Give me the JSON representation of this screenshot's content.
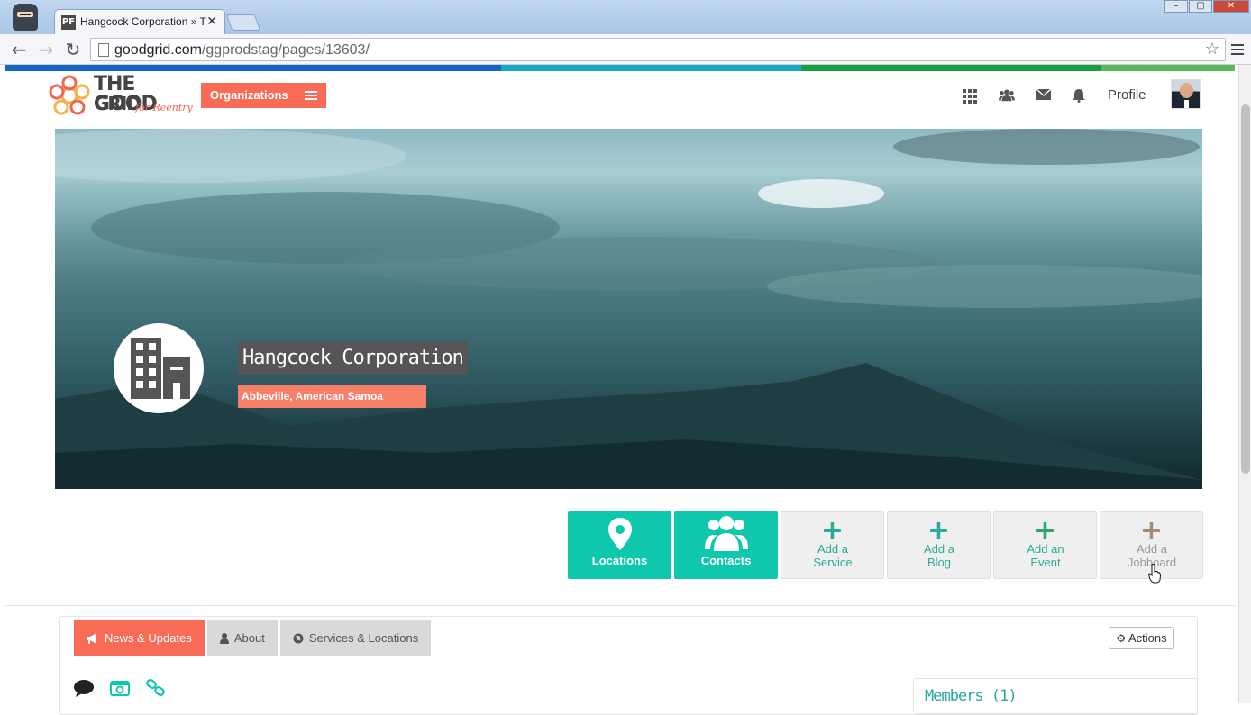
{
  "browser": {
    "tab_title": "Hangcock Corporation » T",
    "tab_favicon": "PF",
    "url_host": "goodgrid.com",
    "url_path": "/ggprodstag/pages/13603/"
  },
  "colorbar": [
    "#1565c0",
    "#1e88e5",
    "#17a9c3",
    "#10a6a0",
    "#1b9e43",
    "#5cb85c"
  ],
  "header": {
    "logo_line1": "THE GOOD",
    "logo_line2": "GRID",
    "logo_tagline": "for Reentry",
    "org_button_label": "Organizations",
    "profile_label": "Profile"
  },
  "hero": {
    "org_name": "Hangcock Corporation",
    "org_location": "Abbeville, American Samoa"
  },
  "action_tiles": [
    {
      "label": "Locations",
      "icon": "map-pin-icon"
    },
    {
      "label": "Contacts",
      "icon": "users-icon"
    },
    {
      "label": "Add a Service",
      "icon": "plus-icon"
    },
    {
      "label": "Add a Blog",
      "icon": "plus-icon"
    },
    {
      "label": "Add an Event",
      "icon": "plus-icon"
    },
    {
      "label": "Add a Jobboard",
      "icon": "plus-icon"
    }
  ],
  "tabs": [
    {
      "label": "News & Updates",
      "icon": "megaphone-icon",
      "active": true
    },
    {
      "label": "About",
      "icon": "user-icon",
      "active": false
    },
    {
      "label": "Services & Locations",
      "icon": "globe-icon",
      "active": false
    }
  ],
  "actions_button_label": "Actions",
  "members": {
    "title": "Members (1)"
  },
  "colors": {
    "accent": "#f76b57",
    "teal": "#0fc7ad",
    "teal_text": "#2aa99a"
  }
}
